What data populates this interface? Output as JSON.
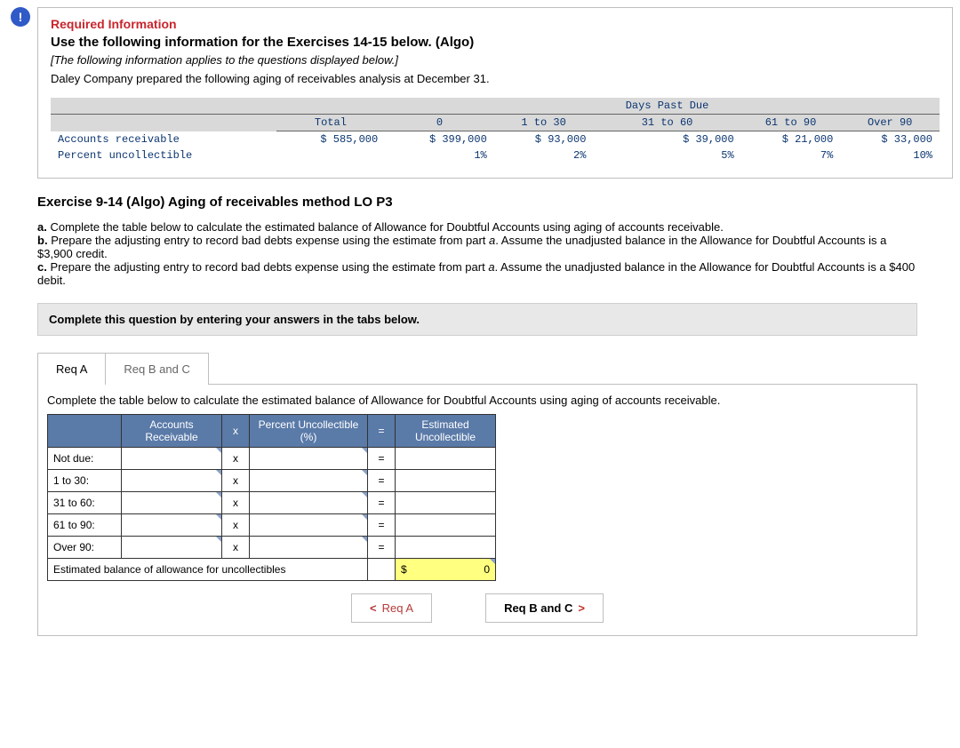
{
  "required": {
    "heading": "Required Information",
    "line1_bold": "Use the following information for the Exercises 14-15 below. (Algo)",
    "line2_italic": "[The following information applies to the questions displayed below.]",
    "line3": "Daley Company prepared the following aging of receivables analysis at December 31."
  },
  "aging": {
    "col_total": "Total",
    "col_0": "0",
    "col_1_30": "1 to 30",
    "dpd": "Days Past Due",
    "col_31_60": "31 to 60",
    "col_61_90": "61 to 90",
    "col_over_90": "Over 90",
    "ar_label": "Accounts receivable",
    "pu_label": "Percent uncollectible",
    "total": "$ 585,000",
    "v_0": "$ 399,000",
    "v_1_30": "$ 93,000",
    "v_31_60": "$ 39,000",
    "v_61_90": "$ 21,000",
    "v_over_90": "$ 33,000",
    "p_0": "1%",
    "p_1_30": "2%",
    "p_31_60": "5%",
    "p_61_90": "7%",
    "p_over_90": "10%"
  },
  "exercise_title": "Exercise 9-14 (Algo) Aging of receivables method LO P3",
  "parts": {
    "a_label": "a.",
    "a_text": "Complete the table below to calculate the estimated balance of Allowance for Doubtful Accounts using aging of accounts receivable.",
    "b_label": "b.",
    "b_text_1": "Prepare the adjusting entry to record bad debts expense using the estimate from part ",
    "b_text_em": "a",
    "b_text_2": ". Assume the unadjusted balance in the Allowance for Doubtful Accounts is a $3,900 credit.",
    "c_label": "c.",
    "c_text_1": "Prepare the adjusting entry to record bad debts expense using the estimate from part ",
    "c_text_em": "a",
    "c_text_2": ". Assume the unadjusted balance in the Allowance for Doubtful Accounts is a $400 debit."
  },
  "hint": "Complete this question by entering your answers in the tabs below.",
  "tabs": {
    "a": "Req A",
    "bc": "Req B and C"
  },
  "prompt": "Complete the table below to calculate the estimated balance of Allowance for Doubtful Accounts using aging of accounts receivable.",
  "calc": {
    "h_ar": "Accounts Receivable",
    "h_x": "x",
    "h_pct": "Percent Uncollectible (%)",
    "h_eq": "=",
    "h_est": "Estimated Uncollectible",
    "rows": [
      "Not due:",
      "1 to 30:",
      "31 to 60:",
      "61 to 90:",
      "Over 90:"
    ],
    "x": "x",
    "eq": "=",
    "total_label": "Estimated balance of allowance for uncollectibles",
    "dollar": "$",
    "total_value": "0"
  },
  "nav": {
    "prev_chev": "<",
    "prev": "Req A",
    "next": "Req B and C",
    "next_chev": ">"
  },
  "alert_glyph": "!"
}
